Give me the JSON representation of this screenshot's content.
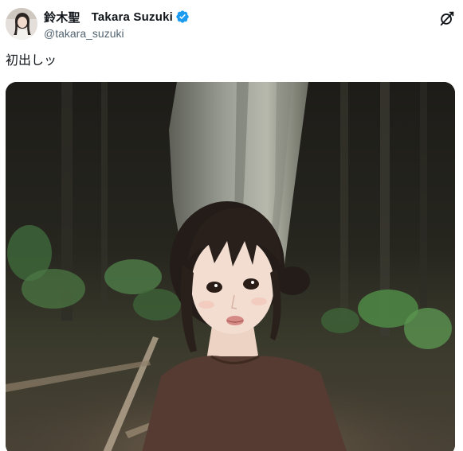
{
  "author": {
    "display_name": "鈴木聖",
    "romaji_name": "Takara Suzuki",
    "handle": "@takara_suzuki",
    "verified": true
  },
  "tweet": {
    "text": "初出しッ"
  },
  "icons": {
    "verified": "verified-badge-icon",
    "grok": "grok-icon"
  },
  "colors": {
    "verified_blue": "#1d9bf0",
    "handle_gray": "#536471",
    "text_black": "#0f1419"
  }
}
